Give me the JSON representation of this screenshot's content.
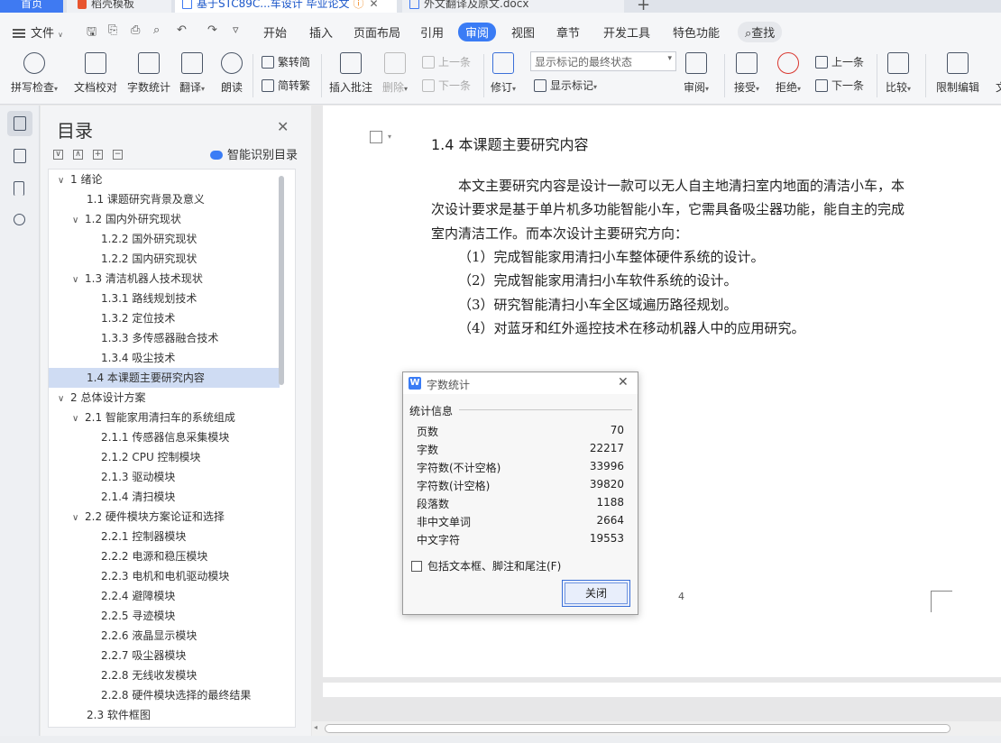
{
  "tabs": {
    "home": "首页",
    "t2": "稻壳模板",
    "t3": "基于STC89C...车设计 毕业论文",
    "t4": "外文翻译及原文.docx",
    "new_tab": "+"
  },
  "menu": {
    "file": "文件",
    "items": [
      "开始",
      "插入",
      "页面布局",
      "引用",
      "审阅",
      "视图",
      "章节",
      "开发工具",
      "特色功能"
    ],
    "active_index": 4,
    "search": "查找"
  },
  "ribbon": {
    "spell": "拼写检查",
    "proof": "文档校对",
    "wordcount": "字数统计",
    "translate": "翻译",
    "read": "朗读",
    "to_trad": "繁转简",
    "to_simp": "简转繁",
    "insert_comment": "插入批注",
    "delete": "删除",
    "prev1": "上一条",
    "next1": "下一条",
    "revise": "修订",
    "markup_state": "显示标记的最终状态",
    "show_markup": "显示标记",
    "review": "审阅",
    "accept": "接受",
    "reject": "拒绝",
    "prev2": "上一条",
    "next2": "下一条",
    "compare": "比较",
    "restrict": "限制编辑",
    "more": "文"
  },
  "toc": {
    "title": "目录",
    "smart": "智能识别目录",
    "items": [
      {
        "label": "1  绪论",
        "level": 0,
        "twisty": "∨"
      },
      {
        "label": "1.1  课题研究背景及意义",
        "level": 1,
        "twisty": ""
      },
      {
        "label": "1.2  国内外研究现状",
        "level": 1,
        "twisty": "∨"
      },
      {
        "label": "1.2.2  国外研究现状",
        "level": 2,
        "twisty": ""
      },
      {
        "label": "1.2.2  国内研究现状",
        "level": 2,
        "twisty": ""
      },
      {
        "label": "1.3  清洁机器人技术现状",
        "level": 1,
        "twisty": "∨"
      },
      {
        "label": "1.3.1  路线规划技术",
        "level": 2,
        "twisty": ""
      },
      {
        "label": "1.3.2  定位技术",
        "level": 2,
        "twisty": ""
      },
      {
        "label": "1.3.3  多传感器融合技术",
        "level": 2,
        "twisty": ""
      },
      {
        "label": "1.3.4  吸尘技术",
        "level": 2,
        "twisty": ""
      },
      {
        "label": "1.4  本课题主要研究内容",
        "level": 1,
        "twisty": "",
        "selected": true
      },
      {
        "label": "2  总体设计方案",
        "level": 0,
        "twisty": "∨"
      },
      {
        "label": "2.1  智能家用清扫车的系统组成",
        "level": 1,
        "twisty": "∨"
      },
      {
        "label": "2.1.1  传感器信息采集模块",
        "level": 2,
        "twisty": ""
      },
      {
        "label": "2.1.2 CPU 控制模块",
        "level": 2,
        "twisty": ""
      },
      {
        "label": "2.1.3  驱动模块",
        "level": 2,
        "twisty": ""
      },
      {
        "label": "2.1.4  清扫模块",
        "level": 2,
        "twisty": ""
      },
      {
        "label": "2.2  硬件模块方案论证和选择",
        "level": 1,
        "twisty": "∨"
      },
      {
        "label": "2.2.1  控制器模块",
        "level": 2,
        "twisty": ""
      },
      {
        "label": "2.2.2  电源和稳压模块",
        "level": 2,
        "twisty": ""
      },
      {
        "label": "2.2.3  电机和电机驱动模块",
        "level": 2,
        "twisty": ""
      },
      {
        "label": "2.2.4  避障模块",
        "level": 2,
        "twisty": ""
      },
      {
        "label": "2.2.5  寻迹模块",
        "level": 2,
        "twisty": ""
      },
      {
        "label": "2.2.6  液晶显示模块",
        "level": 2,
        "twisty": ""
      },
      {
        "label": "2.2.7  吸尘器模块",
        "level": 2,
        "twisty": ""
      },
      {
        "label": "2.2.8  无线收发模块",
        "level": 2,
        "twisty": ""
      },
      {
        "label": "2.2.8  硬件模块选择的最终结果",
        "level": 2,
        "twisty": ""
      },
      {
        "label": "2.3  软件框图",
        "level": 1,
        "twisty": ""
      }
    ]
  },
  "doc": {
    "heading": "1.4  本课题主要研究内容",
    "lines": [
      "本文主要研究内容是设计一款可以无人自主地清扫室内地面的清洁小车，本",
      "次设计要求是基于单片机多功能智能小车，它需具备吸尘器功能，能自主的完成",
      "室内清洁工作。而本次设计主要研究方向：",
      "（1）完成智能家用清扫小车整体硬件系统的设计。",
      "（2）完成智能家用清扫小车软件系统的设计。",
      "（3）研究智能清扫小车全区域遍历路径规划。",
      "（4）对蓝牙和红外遥控技术在移动机器人中的应用研究。"
    ],
    "page_number": "4"
  },
  "dialog": {
    "title": "字数统计",
    "group": "统计信息",
    "rows": [
      {
        "k": "页数",
        "v": "70"
      },
      {
        "k": "字数",
        "v": "22217"
      },
      {
        "k": "字符数(不计空格)",
        "v": "33996"
      },
      {
        "k": "字符数(计空格)",
        "v": "39820"
      },
      {
        "k": "段落数",
        "v": "1188"
      },
      {
        "k": "非中文单词",
        "v": "2664"
      },
      {
        "k": "中文字符",
        "v": "19553"
      }
    ],
    "checkbox": "包括文本框、脚注和尾注(F)",
    "close": "关闭"
  },
  "colors": {
    "accent": "#3a7cf5",
    "toc_selected": "#cfdcf3"
  }
}
